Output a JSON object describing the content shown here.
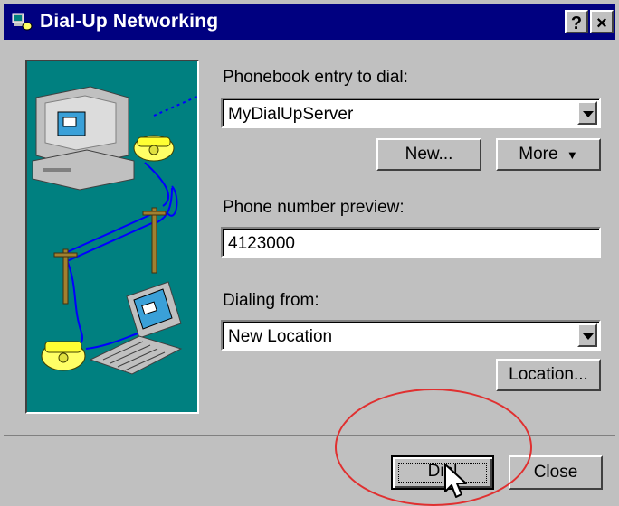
{
  "window": {
    "title": "Dial-Up Networking",
    "help_label": "?",
    "close_label": "×"
  },
  "phonebook": {
    "label": "Phonebook entry to dial:",
    "value": "MyDialUpServer"
  },
  "buttons": {
    "new": "New...",
    "more": "More",
    "location": "Location...",
    "dial": "Dial",
    "close": "Close"
  },
  "preview": {
    "label": "Phone number preview:",
    "value": "4123000"
  },
  "dialing_from": {
    "label": "Dialing from:",
    "value": "New Location"
  },
  "colors": {
    "title_bar": "#000080",
    "dialog_face": "#c0c0c0",
    "art_background": "#008080",
    "annotation": "#e03030"
  }
}
